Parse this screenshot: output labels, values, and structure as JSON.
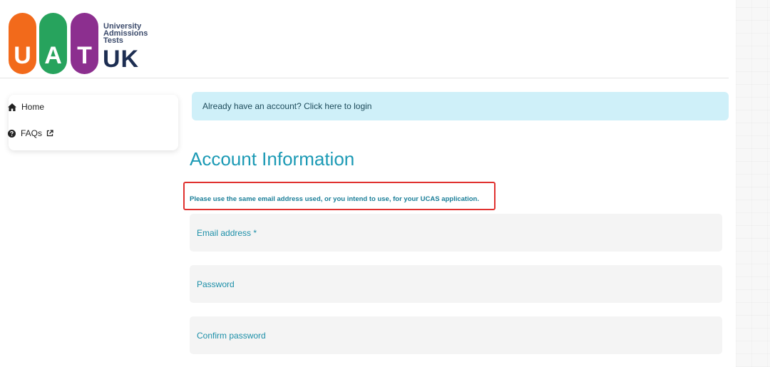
{
  "logo": {
    "letters": [
      "U",
      "A",
      "T"
    ],
    "tagline_lines": [
      "University",
      "Admissions",
      "Tests"
    ],
    "suffix": "UK",
    "colors": {
      "u": "#f26a1b",
      "a": "#27a35d",
      "t": "#8c2f8f",
      "text": "#1d2e52"
    }
  },
  "sidebar": {
    "items": [
      {
        "label": "Home",
        "icon": "home-icon"
      },
      {
        "label": "FAQs",
        "icon": "question-circle-icon",
        "trailing_icon": "external-link-icon"
      }
    ]
  },
  "main": {
    "login_alert": "Already have an account? Click here to login",
    "title": "Account Information",
    "notice": "Please use the same email address used, or you intend to use, for your UCAS application.",
    "fields": [
      {
        "label": "Email address *"
      },
      {
        "label": "Password"
      },
      {
        "label": "Confirm password"
      }
    ]
  },
  "colors": {
    "accent": "#1c9ab5",
    "alert_bg": "#cff0f9",
    "highlight": "#e0312f",
    "field_bg": "#f4f4f4"
  }
}
